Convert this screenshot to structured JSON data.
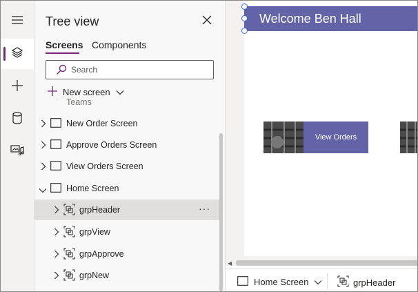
{
  "panel": {
    "title": "Tree view",
    "tabs": [
      "Screens",
      "Components"
    ],
    "search_placeholder": "Search",
    "new_screen_label": "New screen"
  },
  "tree": {
    "partial_item": "Teams",
    "screens": [
      {
        "label": "New Order Screen",
        "expanded": false
      },
      {
        "label": "Approve Orders Screen",
        "expanded": false
      },
      {
        "label": "View Orders Screen",
        "expanded": false
      },
      {
        "label": "Home Screen",
        "expanded": true
      }
    ],
    "children": [
      {
        "label": "grpHeader",
        "selected": true
      },
      {
        "label": "grpView",
        "selected": false
      },
      {
        "label": "grpApprove",
        "selected": false
      },
      {
        "label": "grpNew",
        "selected": false
      }
    ],
    "more_label": "···"
  },
  "canvas": {
    "header_text": "Welcome Ben Hall",
    "card_button_label": "View Orders"
  },
  "statusbar": {
    "screen_label": "Home Screen",
    "component_label": "grpHeader"
  },
  "icons": {
    "rail": [
      "hamburger-icon",
      "layers-icon",
      "plus-icon",
      "database-icon",
      "media-icon"
    ]
  },
  "colors": {
    "accent": "#742774",
    "header": "#6264a7",
    "selection": "#e1dfdd"
  }
}
